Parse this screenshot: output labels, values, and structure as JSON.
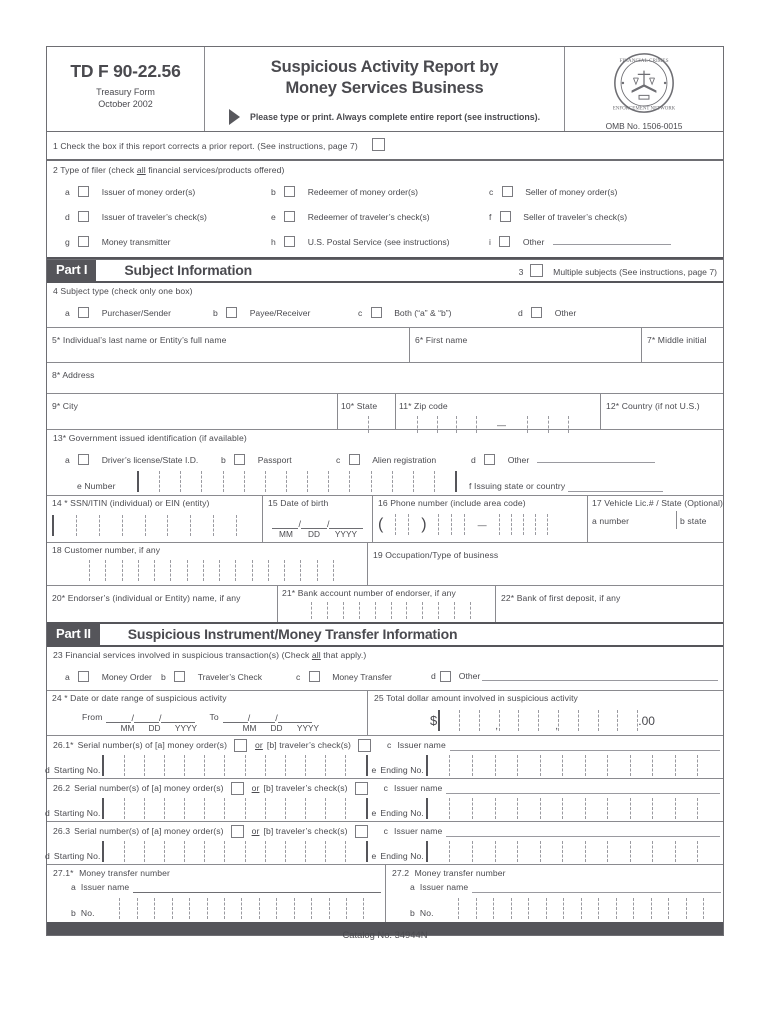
{
  "header": {
    "form_number": "TD F 90-22.56",
    "form_sub1": "Treasury Form",
    "form_sub2": "October 2002",
    "title_line1": "Suspicious Activity Report by",
    "title_line2": "Money Services Business",
    "instruction": "Please type or print. Always complete entire report (see instructions).",
    "seal_top_text": "FINANCIAL CRIMES",
    "seal_bottom_text": "ENFORCEMENT NETWORK",
    "omb": "OMB No. 1506-0015"
  },
  "item1": {
    "label": "1 Check the box if this report corrects a prior report. (See instructions, page 7)"
  },
  "item2": {
    "label_pre": "2   Type of filer (check ",
    "label_all": "all",
    "label_post": " financial services/products offered)",
    "options": [
      {
        "letter": "a",
        "label": "Issuer of money order(s)"
      },
      {
        "letter": "b",
        "label": "Redeemer of money order(s)"
      },
      {
        "letter": "c",
        "label": "Seller of money order(s)"
      },
      {
        "letter": "d",
        "label": "Issuer of traveler’s check(s)"
      },
      {
        "letter": "e",
        "label": "Redeemer of traveler’s check(s)"
      },
      {
        "letter": "f",
        "label": "Seller of traveler’s check(s)"
      },
      {
        "letter": "g",
        "label": "Money transmitter"
      },
      {
        "letter": "h",
        "label": "U.S. Postal Service (see instructions)"
      },
      {
        "letter": "i",
        "label": "Other"
      }
    ]
  },
  "part1": {
    "tag": "Part I",
    "title": "Subject Information",
    "multiple_num": "3",
    "multiple_label": "Multiple subjects (See instructions, page 7)"
  },
  "item4": {
    "label": "4   Subject type   (check only one box)",
    "options": [
      {
        "letter": "a",
        "label": "Purchaser/Sender"
      },
      {
        "letter": "b",
        "label": "Payee/Receiver"
      },
      {
        "letter": "c",
        "label": "Both  (“a” & “b”)"
      },
      {
        "letter": "d",
        "label": "Other"
      }
    ]
  },
  "item5": {
    "label": "5*"
  },
  "item5_text": {
    "label": "Individual’s last name or Entity’s full name"
  },
  "item6": {
    "label": "6*   First name"
  },
  "item7": {
    "label": "7*  Middle initial"
  },
  "item8": {
    "label": "8*  Address"
  },
  "item9": {
    "label": "9* City"
  },
  "item10": {
    "label": "10* State"
  },
  "item11": {
    "label": "11*  Zip code"
  },
  "item12": {
    "label": "12* Country (if not U.S.)"
  },
  "item13": {
    "label": "13*  Government issued identification (if available)",
    "options": [
      {
        "letter": "a",
        "label": "Driver’s license/State I.D."
      },
      {
        "letter": "b",
        "label": "Passport"
      },
      {
        "letter": "c",
        "label": "Alien registration"
      },
      {
        "letter": "d",
        "label": "Other"
      }
    ],
    "number_label": "e  Number",
    "issuing_label": "f  Issuing state or country"
  },
  "item14": {
    "label": "14 *  SSN/ITIN (individual) or EIN (entity)"
  },
  "item15": {
    "label": "15   Date of birth",
    "mm": "MM",
    "dd": "DD",
    "yyyy": "YYYY"
  },
  "item16": {
    "label": "16   Phone number (include area code)"
  },
  "item17": {
    "label": "17 Vehicle Lic.# / State (Optional)",
    "a_label": "a   number",
    "b_label": "b  state"
  },
  "item18": {
    "label": "18   Customer number, if any"
  },
  "item19": {
    "label": "19   Occupation/Type of business"
  },
  "item20": {
    "label": "20*   Endorser’s (individual or Entity) name, if any"
  },
  "item21": {
    "label": "21*   Bank account number of endorser, if any"
  },
  "item22": {
    "label": "22* Bank of first deposit, if any"
  },
  "part2": {
    "tag": "Part II",
    "title": "Suspicious Instrument/Money Transfer Information"
  },
  "item23": {
    "label_pre": "23   Financial services involved in suspicious transaction(s)   (Check ",
    "label_all": "all",
    "label_post": " that apply.)",
    "options": [
      {
        "letter": "a",
        "label": "Money Order"
      },
      {
        "letter": "b",
        "label": "Traveler’s Check"
      },
      {
        "letter": "c",
        "label": "Money Transfer"
      },
      {
        "letter": "d",
        "label": "Other"
      }
    ]
  },
  "item24": {
    "label": "24 *  Date or date range of suspicious activity",
    "from_label": "From",
    "to_label": "To",
    "mm": "MM",
    "dd": "DD",
    "yyyy": "YYYY"
  },
  "item25": {
    "label": "25   Total dollar amount involved in suspicious activity",
    "dollar_sign": "$",
    "cents": ".00"
  },
  "serial_blocks": [
    {
      "num": "26.1*",
      "label_pre": "Serial number(s) of [a] money order(s)",
      "or_text": "or",
      "label_post": "[b] traveler’s check(s)",
      "issuer_letter": "c",
      "issuer_label": "Issuer name",
      "start_letter": "d",
      "start_label": "Starting No.",
      "end_letter": "e",
      "end_label": "Ending No."
    },
    {
      "num": "26.2",
      "label_pre": "Serial number(s) of [a] money order(s)",
      "or_text": "or",
      "label_post": "[b] traveler’s check(s)",
      "issuer_letter": "c",
      "issuer_label": "Issuer name",
      "start_letter": "d",
      "start_label": "Starting No.",
      "end_letter": "e",
      "end_label": "Ending No."
    },
    {
      "num": "26.3",
      "label_pre": "Serial number(s) of [a] money order(s)",
      "or_text": "or",
      "label_post": "[b] traveler’s check(s)",
      "issuer_letter": "c",
      "issuer_label": "Issuer name",
      "start_letter": "d",
      "start_label": "Starting No.",
      "end_letter": "e",
      "end_label": "Ending No."
    }
  ],
  "transfer_blocks": [
    {
      "num": "27.1*",
      "label": "Money transfer number",
      "issuer_letter": "a",
      "issuer_label": "Issuer name",
      "no_letter": "b",
      "no_label": "No."
    },
    {
      "num": "27.2",
      "label": "Money transfer number",
      "issuer_letter": "a",
      "issuer_label": "Issuer name",
      "no_letter": "b",
      "no_label": "No."
    }
  ],
  "footer": {
    "catalog": "Catalog No.  34944N"
  }
}
